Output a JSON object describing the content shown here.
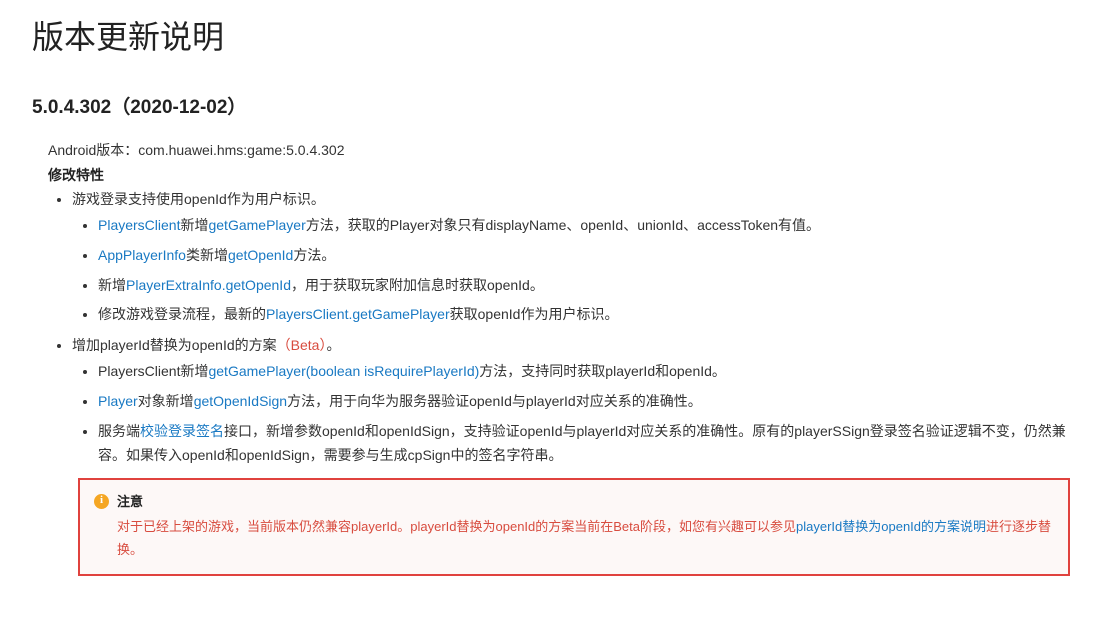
{
  "title": "版本更新说明",
  "version_header": "5.0.4.302（2020-12-02）",
  "android_line": "Android版本：com.huawei.hms:game:5.0.4.302",
  "features_label": "修改特性",
  "item1": {
    "text": "游戏登录支持使用openId作为用户标识。",
    "subs": {
      "a": {
        "pre": "",
        "link1": "PlayersClient",
        "mid1": "新增",
        "link2": "getGamePlayer",
        "post": "方法，获取的Player对象只有displayName、openId、unionId、accessToken有值。"
      },
      "b": {
        "link1": "AppPlayerInfo",
        "mid1": "类新增",
        "link2": "getOpenId",
        "post": "方法。"
      },
      "c": {
        "pre": "新增",
        "link1": "PlayerExtraInfo.getOpenId",
        "post": "，用于获取玩家附加信息时获取openId。"
      },
      "d": {
        "pre": "修改游戏登录流程，最新的",
        "link1": "PlayersClient.getGamePlayer",
        "post": "获取openId作为用户标识。"
      }
    }
  },
  "item2": {
    "pre": "增加playerId替换为openId的方案",
    "beta": "（Beta）",
    "post": "。",
    "subs": {
      "a": {
        "pre": "PlayersClient新增",
        "link1": "getGamePlayer(boolean isRequirePlayerId)",
        "post": "方法，支持同时获取playerId和openId。"
      },
      "b": {
        "link1": "Player",
        "mid1": "对象新增",
        "link2": "getOpenIdSign",
        "post": "方法，用于向华为服务器验证openId与playerId对应关系的准确性。"
      },
      "c": {
        "pre": "服务端",
        "link1": "校验登录签名",
        "post": "接口，新增参数openId和openIdSign，支持验证openId与playerId对应关系的准确性。原有的playerSSign登录签名验证逻辑不变，仍然兼容。如果传入openId和openIdSign，需要参与生成cpSign中的签名字符串。"
      }
    }
  },
  "notice": {
    "label": "注意",
    "body_pre": "对于已经上架的游戏，当前版本仍然兼容playerId。playerId替换为openId的方案当前在Beta阶段，如您有兴趣可以参见",
    "body_link": "playerId替换为openId的方案说明",
    "body_post": "进行逐步替换。"
  }
}
